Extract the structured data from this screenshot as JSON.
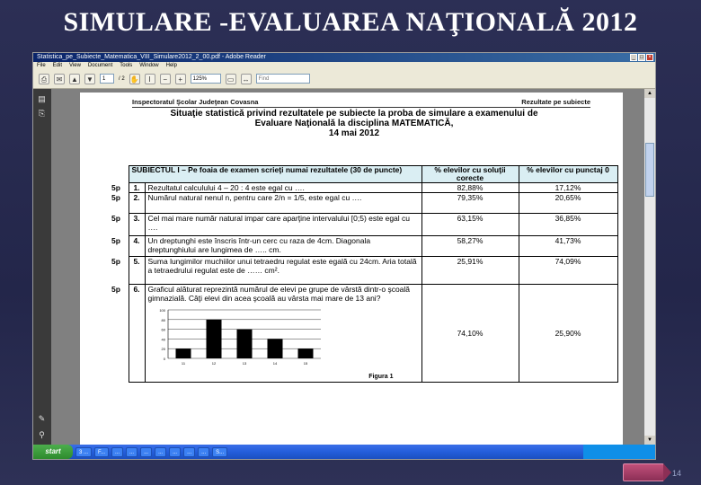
{
  "slide": {
    "title": "SIMULARE -EVALUAREA NAŢIONALĂ 2012",
    "page_number": "14"
  },
  "window": {
    "title": "Statistica_pe_Subiecte_Matematica_VIII_Simulare2012_2_00.pdf - Adobe Reader",
    "menu": [
      "File",
      "Edit",
      "View",
      "Document",
      "Tools",
      "Window",
      "Help"
    ],
    "toolbar": {
      "page_current": "1",
      "page_total": "/ 2",
      "zoom": "125%",
      "find_placeholder": "Find"
    }
  },
  "document": {
    "header_left": "Inspectoratul Şcolar Judeţean Covasna",
    "header_right": "Rezultate pe subiecte",
    "title_line1": "Situaţie statistică privind rezultatele pe subiecte la proba de simulare a examenului de",
    "title_line2": "Evaluare Naţională la disciplina MATEMATICĂ,",
    "title_line3": "14 mai 2012",
    "table": {
      "header_col1": "SUBIECTUL I – Pe foaia de examen scrieţi numai rezultatele (30 de puncte)",
      "header_col2": "% elevilor cu soluţii corecte",
      "header_col3": "% elevilor cu punctaj 0",
      "rows": [
        {
          "points": "5p",
          "num": "1.",
          "text": "Rezultatul calculului 4 – 20 : 4 este egal cu ….",
          "correct": "82,88%",
          "zero": "17,12%"
        },
        {
          "points": "5p",
          "num": "2.",
          "text": "Numărul natural nenul n, pentru care 2/n = 1/5, este egal cu ….",
          "correct": "79,35%",
          "zero": "20,65%"
        },
        {
          "points": "5p",
          "num": "3.",
          "text": "Cel mai mare număr natural impar care aparţine intervalului [0;5) este egal cu ….",
          "correct": "63,15%",
          "zero": "36,85%"
        },
        {
          "points": "5p",
          "num": "4.",
          "text": "Un dreptunghi este înscris într-un cerc cu raza de 4cm. Diagonala dreptunghiului are lungimea de ….. cm.",
          "correct": "58,27%",
          "zero": "41,73%"
        },
        {
          "points": "5p",
          "num": "5.",
          "text": "Suma lungimilor muchiilor unui tetraedru regulat este egală cu 24cm. Aria totală a tetraedrului regulat este de …… cm².",
          "correct": "25,91%",
          "zero": "74,09%"
        },
        {
          "points": "5p",
          "num": "6.",
          "text": "Graficul alăturat reprezintă numărul de elevi pe grupe de vârstă dintr-o şcoală gimnazială. Câţi elevi din acea şcoală au vârsta mai mare de 13 ani?",
          "correct": "74,10%",
          "zero": "25,90%"
        }
      ]
    },
    "figure_caption": "Figura 1"
  },
  "chart_data": {
    "type": "bar",
    "categories": [
      "11",
      "12",
      "13",
      "14",
      "15"
    ],
    "values": [
      20,
      80,
      60,
      40,
      20
    ],
    "ylim": [
      0,
      100
    ],
    "yticks": [
      "0",
      "20",
      "40",
      "60",
      "80",
      "100"
    ],
    "grid": true,
    "bar_color": "#000000"
  },
  "taskbar": {
    "start_label": "start",
    "tasks": [
      "3 ...",
      "F...",
      "...",
      "...",
      "...",
      "...",
      "...",
      "...",
      "...",
      "S..."
    ],
    "clock": ""
  }
}
